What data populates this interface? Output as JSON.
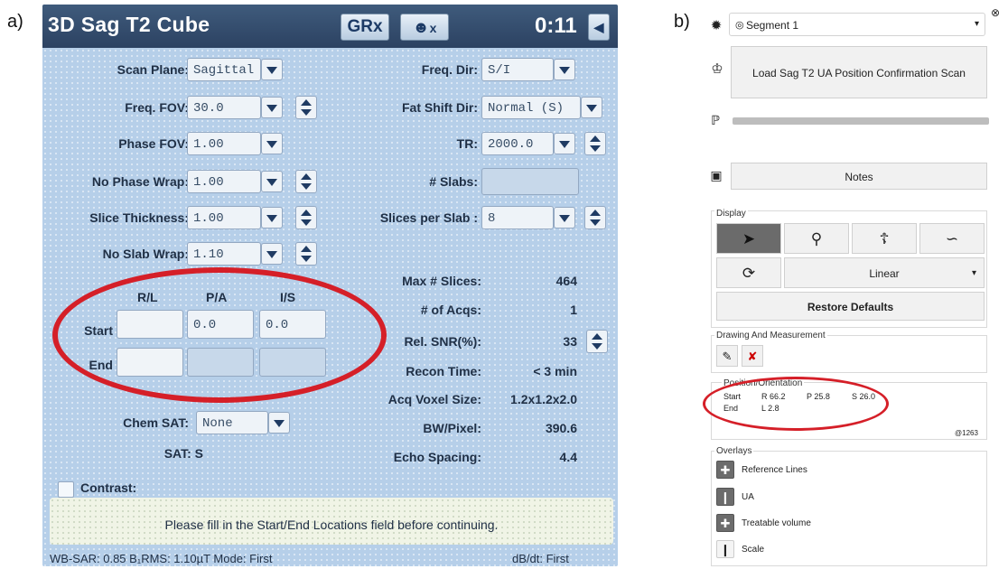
{
  "labels": {
    "panel_a": "a)",
    "panel_b": "b)"
  },
  "mri": {
    "title": "3D Sag T2 Cube",
    "grx_button": "GRx",
    "patient_button": "x",
    "timer": "0:11",
    "fields_left": [
      {
        "label": "Scan Plane:",
        "value": "Sagittal"
      },
      {
        "label": "Freq. FOV:",
        "value": "30.0"
      },
      {
        "label": "Phase FOV:",
        "value": "1.00"
      },
      {
        "label": "No Phase Wrap:",
        "value": "1.00"
      },
      {
        "label": "Slice Thickness:",
        "value": "1.00"
      },
      {
        "label": "No Slab Wrap:",
        "value": "1.10"
      }
    ],
    "fields_right": [
      {
        "label": "Freq. Dir:",
        "value": "S/I"
      },
      {
        "label": "Fat Shift Dir:",
        "value": "Normal (S)"
      },
      {
        "label": "TR:",
        "value": "2000.0"
      },
      {
        "label": "# Slabs:",
        "value": ""
      },
      {
        "label": "Slices per Slab :",
        "value": "8"
      }
    ],
    "loc_headers": [
      "R/L",
      "P/A",
      "I/S"
    ],
    "start_label": "Start",
    "end_label": "End",
    "start_values": [
      "",
      "0.0",
      "0.0"
    ],
    "end_values": [
      "",
      "",
      ""
    ],
    "info": [
      {
        "label": "Max # Slices:",
        "value": "464"
      },
      {
        "label": "# of Acqs:",
        "value": "1"
      },
      {
        "label": "Rel. SNR(%):",
        "value": "33"
      },
      {
        "label": "Recon Time:",
        "value": "< 3 min"
      },
      {
        "label": "Acq Voxel Size:",
        "value": "1.2x1.2x2.0"
      },
      {
        "label": "BW/Pixel:",
        "value": "390.6"
      },
      {
        "label": "Echo Spacing:",
        "value": "4.4"
      }
    ],
    "chem_sat_label": "Chem SAT:",
    "chem_sat_value": "None",
    "sat_label": "SAT: S",
    "contrast_label": "Contrast:",
    "message": "Please fill in the Start/End Locations field before continuing.",
    "status_left": "WB-SAR: 0.85  B₁RMS: 1.10µT  Mode: First",
    "status_right": "dB/dt: First",
    "highlight_color": "#d51f28"
  },
  "right_panel": {
    "segment": "Segment 1",
    "load_scan": "Load Sag T2 UA Position Confirmation Scan",
    "notes": "Notes",
    "display_title": "Display",
    "interp": "Linear",
    "restore": "Restore Defaults",
    "drawing_title": "Drawing And Measurement",
    "position_title": "Position/Orientation",
    "pos_start_label": "Start",
    "pos_start_r": "R 66.2",
    "pos_start_p": "P 25.8",
    "pos_start_s": "S 26.0",
    "pos_end_label": "End",
    "pos_end_l": "L 2.8",
    "pos_small": "@1263",
    "overlays_title": "Overlays",
    "overlays": [
      {
        "label": "Reference Lines",
        "icon": "crosshair-icon"
      },
      {
        "label": "UA",
        "icon": "ua-icon"
      },
      {
        "label": "Treatable volume",
        "icon": "target-icon"
      },
      {
        "label": "Scale",
        "icon": "scale-icon"
      }
    ]
  }
}
